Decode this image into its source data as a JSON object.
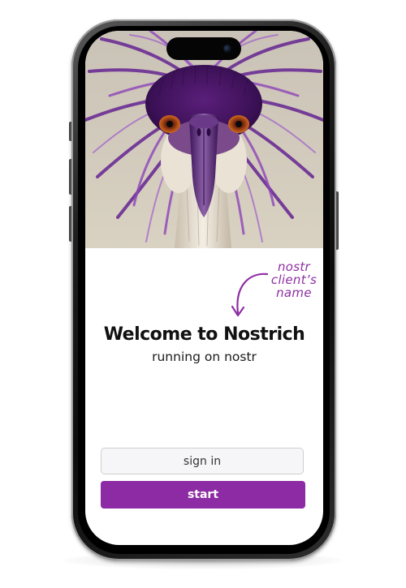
{
  "app": {
    "name": "Nostrich"
  },
  "hero": {
    "image": "purple-feathered-ostrich-illustration"
  },
  "annotation": {
    "lines": [
      "nostr",
      "client’s",
      "name"
    ],
    "color": "#8e2ea3"
  },
  "welcome": {
    "title": "Welcome to Nostrich",
    "subtitle": "running on nostr"
  },
  "actions": {
    "signin_label": "sign in",
    "start_label": "start",
    "start_color": "#8d2ba4"
  }
}
